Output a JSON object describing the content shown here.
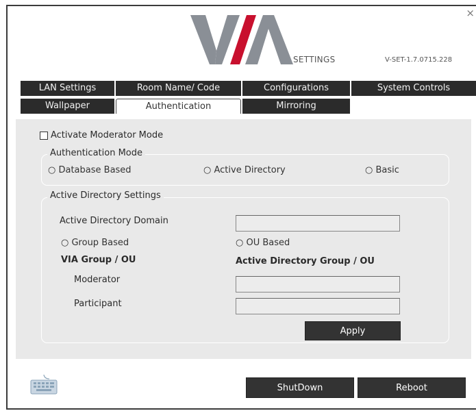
{
  "header": {
    "logo_text": "VIA",
    "settings_label": "SETTINGS",
    "version": "V-SET-1.7.0715.228",
    "close_glyph": "×"
  },
  "tabs": {
    "row1": [
      "LAN Settings",
      "Room Name/ Code",
      "Configurations",
      "System Controls"
    ],
    "row2": [
      "Wallpaper",
      "Authentication",
      "Mirroring"
    ],
    "active": "Authentication"
  },
  "moderator": {
    "checkbox_label": "Activate Moderator Mode",
    "checked": false
  },
  "auth_mode": {
    "legend": "Authentication Mode",
    "options": [
      "Database Based",
      "Active Directory",
      "Basic"
    ]
  },
  "ad_settings": {
    "legend": "Active Directory Settings",
    "domain_label": "Active Directory Domain",
    "domain_value": "",
    "group_based_label": "Group Based",
    "ou_based_label": "OU Based",
    "via_group_heading": "VIA Group / OU",
    "ad_group_heading": "Active Directory Group / OU",
    "moderator_label": "Moderator",
    "moderator_value": "",
    "participant_label": "Participant",
    "participant_value": "",
    "apply_label": "Apply"
  },
  "footer": {
    "shutdown_label": "ShutDown",
    "reboot_label": "Reboot",
    "keyboard_icon": "keyboard-icon"
  },
  "colors": {
    "tab_bg": "#2b2b2b",
    "panel_bg": "#e9e9e9",
    "logo_red": "#c8102e",
    "logo_gray": "#8a8f96"
  }
}
